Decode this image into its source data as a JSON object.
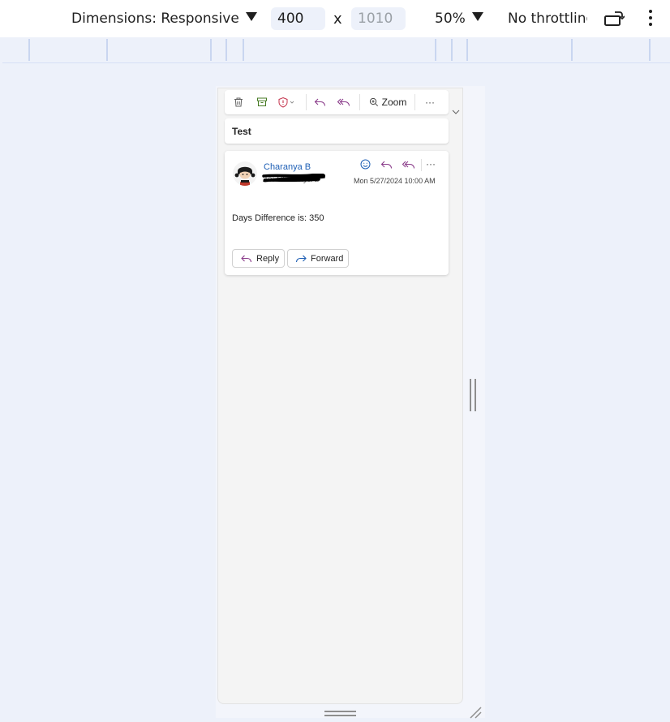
{
  "devtools": {
    "dimensions_label": "Dimensions: Responsive",
    "width_value": "400",
    "height_placeholder": "1010",
    "times_sign": "x",
    "zoom_label": "50%",
    "throttling_label": "No throttling",
    "icons": [
      "dropdown-triangle-icon",
      "rotate-icon",
      "more-vert-icon"
    ]
  },
  "toolbar": {
    "zoom_label": "Zoom",
    "more_label": "···",
    "icons": [
      "delete-icon",
      "archive-icon",
      "report-icon",
      "reply-icon",
      "reply-all-icon",
      "zoom-icon",
      "more-icon"
    ],
    "accent_color": "#8a3c8a"
  },
  "message": {
    "subject": "Test",
    "sender_name": "Charanya B",
    "to_line": "To: Charanya B",
    "date": "Mon 5/27/2024 10:00 AM",
    "body": "Days Difference is: 350",
    "reply_label": "Reply",
    "forward_label": "Forward",
    "more_label": "···",
    "sender_color": "#1e5fb5"
  }
}
